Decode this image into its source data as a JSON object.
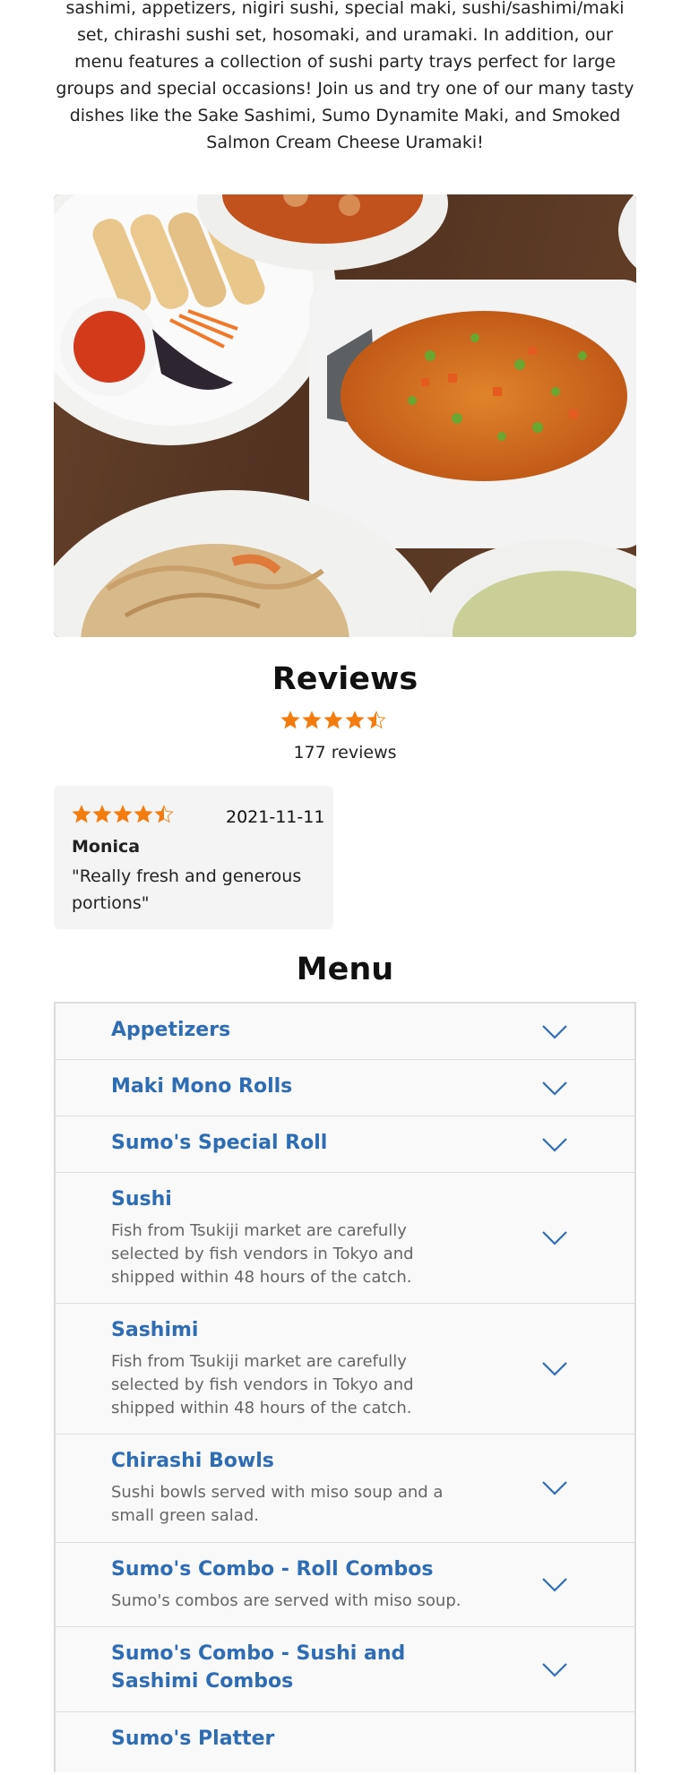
{
  "intro": {
    "text": "sashimi, appetizers, nigiri sushi, special maki, sushi/sashimi/maki set, chirashi sushi set, hosomaki, and uramaki. In addition, our menu features a collection of sushi party trays perfect for large groups and special occasions! Join us and try one of our many tasty dishes like the Sake Sashimi, Sumo Dynamite Maki, and Smoked Salmon Cream Cheese Uramaki!"
  },
  "photo": {
    "subject": "food-photo"
  },
  "reviews": {
    "title": "Reviews",
    "rating": 4.5,
    "count_label": "177 reviews",
    "star_color": "#f47c0e",
    "items": [
      {
        "rating": 4.5,
        "date": "2021-11-11",
        "author": "Monica",
        "text": "\"Really fresh and generous portions\""
      }
    ]
  },
  "menu": {
    "title": "Menu",
    "accent": "#2e6db3",
    "items": [
      {
        "name": "Appetizers",
        "description": ""
      },
      {
        "name": "Maki Mono Rolls",
        "description": ""
      },
      {
        "name": "Sumo's Special Roll",
        "description": ""
      },
      {
        "name": "Sushi",
        "description": "Fish from Tsukiji market are carefully selected by fish vendors in Tokyo and shipped within 48 hours of the catch."
      },
      {
        "name": "Sashimi",
        "description": "Fish from Tsukiji market are carefully selected by fish vendors in Tokyo and shipped within 48 hours of the catch."
      },
      {
        "name": "Chirashi Bowls",
        "description": "Sushi bowls served with miso soup and a small green salad."
      },
      {
        "name": "Sumo's Combo - Roll Combos",
        "description": "Sumo's combos are served with miso soup."
      },
      {
        "name": "Sumo's Combo - Sushi and Sashimi Combos",
        "description": ""
      },
      {
        "name": "Sumo's Platter",
        "description": ""
      }
    ],
    "chevron_icon": "chevron-down-icon"
  }
}
